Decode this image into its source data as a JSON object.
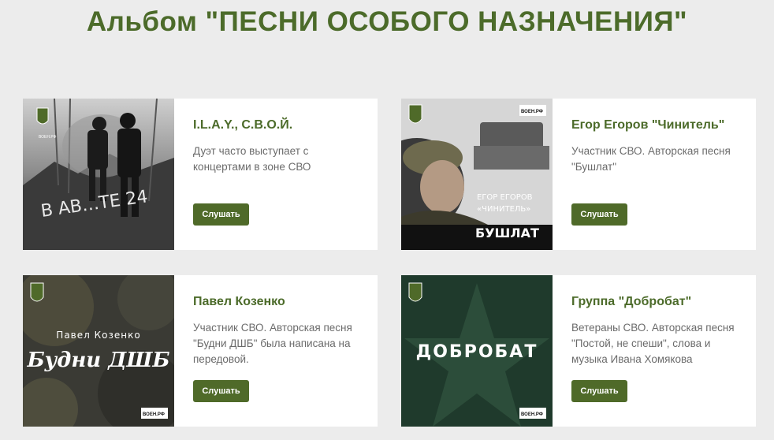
{
  "page": {
    "title": "Альбом \"ПЕСНИ ОСОБОГО НАЗНАЧЕНИЯ\""
  },
  "button_label": "Слушать",
  "brand_label": "ВОЕН.РФ",
  "cards": [
    {
      "title": "I.L.A.Y., С.В.О.Й.",
      "description": "Дуэт часто выступает с концертами в зоне СВО",
      "cover": {
        "graffiti": "В АВ…ТЕ 24"
      }
    },
    {
      "title": "Егор Егоров \"Чинитель\"",
      "description": "Участник СВО. Авторская песня \"Бушлат\"",
      "cover": {
        "artist_line1": "ЕГОР ЕГОРОВ",
        "artist_line2": "«ЧИНИТЕЛЬ»",
        "song": "БУШЛАТ"
      }
    },
    {
      "title": "Павел Козенко",
      "description": "Участник СВО. Авторская песня \"Будни ДШБ\" была написана на передовой.",
      "cover": {
        "artist": "Павел Козенко",
        "song": "Будни ДШБ"
      }
    },
    {
      "title": "Группа \"Добробат\"",
      "description": "Ветераны СВО. Авторская песня \"Постой, не спеши\", слова и музыка Ивана Хомякова",
      "cover": {
        "band": "ДОБРОБАТ"
      }
    }
  ],
  "colors": {
    "accent": "#4c6b2a",
    "button": "#4f6a29",
    "background": "#ececec",
    "card": "#ffffff",
    "text_muted": "#6b6b6b"
  }
}
